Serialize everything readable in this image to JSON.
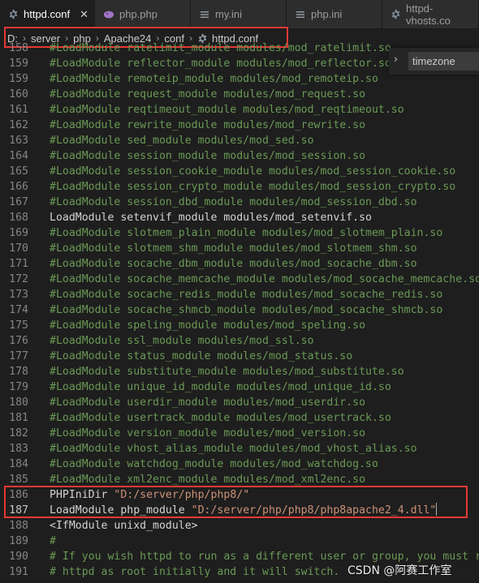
{
  "tabs": [
    {
      "label": "httpd.conf",
      "icon": "gear-icon",
      "active": true,
      "close": "✕"
    },
    {
      "label": "php.php",
      "icon": "php-elephant-icon",
      "active": false
    },
    {
      "label": "my.ini",
      "icon": "lines-file-icon",
      "active": false
    },
    {
      "label": "php.ini",
      "icon": "lines-file-icon",
      "active": false
    },
    {
      "label": "httpd-vhosts.co",
      "icon": "gear-icon",
      "active": false
    }
  ],
  "breadcrumb": [
    "D:",
    "server",
    "php",
    "Apache24",
    "conf",
    "httpd.conf"
  ],
  "find": {
    "value": "timezone",
    "chevron": "›"
  },
  "lines": [
    {
      "n": "158",
      "text": "#LoadModule ratelimit_module modules/mod_ratelimit.so",
      "kind": "comment"
    },
    {
      "n": "159",
      "text": "#LoadModule reflector_module modules/mod_reflector.so",
      "kind": "comment"
    },
    {
      "n": "159",
      "text": "#LoadModule remoteip_module modules/mod_remoteip.so",
      "kind": "comment"
    },
    {
      "n": "160",
      "text": "#LoadModule request_module modules/mod_request.so",
      "kind": "comment"
    },
    {
      "n": "161",
      "text": "#LoadModule reqtimeout_module modules/mod_reqtimeout.so",
      "kind": "comment"
    },
    {
      "n": "162",
      "text": "#LoadModule rewrite_module modules/mod_rewrite.so",
      "kind": "comment"
    },
    {
      "n": "163",
      "text": "#LoadModule sed_module modules/mod_sed.so",
      "kind": "comment"
    },
    {
      "n": "164",
      "text": "#LoadModule session_module modules/mod_session.so",
      "kind": "comment"
    },
    {
      "n": "165",
      "text": "#LoadModule session_cookie_module modules/mod_session_cookie.so",
      "kind": "comment"
    },
    {
      "n": "166",
      "text": "#LoadModule session_crypto_module modules/mod_session_crypto.so",
      "kind": "comment"
    },
    {
      "n": "167",
      "text": "#LoadModule session_dbd_module modules/mod_session_dbd.so",
      "kind": "comment"
    },
    {
      "n": "168",
      "text": "LoadModule setenvif_module modules/mod_setenvif.so",
      "kind": "plain"
    },
    {
      "n": "169",
      "text": "#LoadModule slotmem_plain_module modules/mod_slotmem_plain.so",
      "kind": "comment"
    },
    {
      "n": "170",
      "text": "#LoadModule slotmem_shm_module modules/mod_slotmem_shm.so",
      "kind": "comment"
    },
    {
      "n": "171",
      "text": "#LoadModule socache_dbm_module modules/mod_socache_dbm.so",
      "kind": "comment"
    },
    {
      "n": "172",
      "text": "#LoadModule socache_memcache_module modules/mod_socache_memcache.so",
      "kind": "comment"
    },
    {
      "n": "173",
      "text": "#LoadModule socache_redis_module modules/mod_socache_redis.so",
      "kind": "comment"
    },
    {
      "n": "174",
      "text": "#LoadModule socache_shmcb_module modules/mod_socache_shmcb.so",
      "kind": "comment"
    },
    {
      "n": "175",
      "text": "#LoadModule speling_module modules/mod_speling.so",
      "kind": "comment"
    },
    {
      "n": "176",
      "text": "#LoadModule ssl_module modules/mod_ssl.so",
      "kind": "comment"
    },
    {
      "n": "177",
      "text": "#LoadModule status_module modules/mod_status.so",
      "kind": "comment"
    },
    {
      "n": "178",
      "text": "#LoadModule substitute_module modules/mod_substitute.so",
      "kind": "comment"
    },
    {
      "n": "179",
      "text": "#LoadModule unique_id_module modules/mod_unique_id.so",
      "kind": "comment"
    },
    {
      "n": "180",
      "text": "#LoadModule userdir_module modules/mod_userdir.so",
      "kind": "comment"
    },
    {
      "n": "181",
      "text": "#LoadModule usertrack_module modules/mod_usertrack.so",
      "kind": "comment"
    },
    {
      "n": "182",
      "text": "#LoadModule version_module modules/mod_version.so",
      "kind": "comment"
    },
    {
      "n": "183",
      "text": "#LoadModule vhost_alias_module modules/mod_vhost_alias.so",
      "kind": "comment"
    },
    {
      "n": "184",
      "text": "#LoadModule watchdog_module modules/mod_watchdog.so",
      "kind": "comment"
    },
    {
      "n": "185",
      "text": "#LoadModule xml2enc_module modules/mod_xml2enc.so",
      "kind": "comment"
    },
    {
      "n": "186",
      "pre": "PHPIniDir ",
      "str": "\"D:/server/php/php8/\"",
      "kind": "directive"
    },
    {
      "n": "187",
      "pre": "LoadModule php_module ",
      "str": "\"D:/server/php/php8/php8apache2_4.dll\"",
      "kind": "directive",
      "cursor": true
    },
    {
      "n": "188",
      "text": "<IfModule unixd_module>",
      "kind": "plain"
    },
    {
      "n": "189",
      "text": "#",
      "kind": "comment"
    },
    {
      "n": "190",
      "text": "# If you wish httpd to run as a different user or group, you must run",
      "kind": "comment"
    },
    {
      "n": "191",
      "text": "# httpd as root initially and it will switch.",
      "kind": "comment"
    }
  ],
  "watermark": "CSDN @阿赛工作室",
  "colors": {
    "accent_red": "#e53935",
    "comment": "#6a9955",
    "string": "#ce9178",
    "text": "#d4d4d4"
  }
}
